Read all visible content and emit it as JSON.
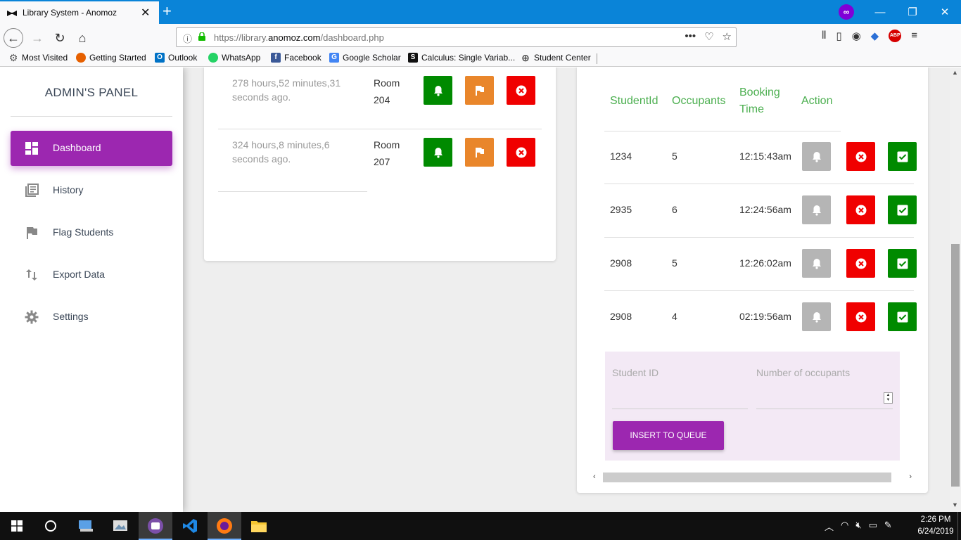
{
  "browser": {
    "tab_title": "Library System - Anomoz",
    "tab_close": "✕",
    "new_tab": "+",
    "url_prefix": "https://library.",
    "url_domain": "anomoz.com",
    "url_path": "/dashboard.php",
    "win_min": "—",
    "win_max": "❐",
    "win_close": "✕",
    "abp_label": "ABP"
  },
  "bookmarks": [
    {
      "label": "Most Visited",
      "icon": "gear-icon",
      "color": "#555555"
    },
    {
      "label": "Getting Started",
      "icon": "firefox-icon",
      "color": "#e66000"
    },
    {
      "label": "Outlook",
      "icon": "outlook-icon",
      "color": "#0072c6"
    },
    {
      "label": "WhatsApp",
      "icon": "whatsapp-icon",
      "color": "#25d366"
    },
    {
      "label": "Facebook",
      "icon": "facebook-icon",
      "color": "#3b5998"
    },
    {
      "label": "Google Scholar",
      "icon": "scholar-icon",
      "color": "#4285f4"
    },
    {
      "label": "Calculus: Single Variab...",
      "icon": "s-icon",
      "color": "#111111"
    },
    {
      "label": "Student Center",
      "icon": "globe-icon",
      "color": "#444444"
    }
  ],
  "sidebar": {
    "title": "ADMIN'S PANEL",
    "items": [
      {
        "label": "Dashboard",
        "icon": "dashboard-icon",
        "active": true
      },
      {
        "label": "History",
        "icon": "history-icon",
        "active": false
      },
      {
        "label": "Flag Students",
        "icon": "flag-icon",
        "active": false
      },
      {
        "label": "Export Data",
        "icon": "import-export-icon",
        "active": false
      },
      {
        "label": "Settings",
        "icon": "settings-icon",
        "active": false
      }
    ]
  },
  "active_bookings": [
    {
      "time": "278 hours,52 minutes,31 seconds ago.",
      "room": "Room 204"
    },
    {
      "time": "324 hours,8 minutes,6 seconds ago.",
      "room": "Room 207"
    }
  ],
  "queue": {
    "headers": {
      "student_id": "StudentId",
      "occupants": "Occupants",
      "booking_time": "Booking Time",
      "action": "Action"
    },
    "rows": [
      {
        "student_id": "1234",
        "occupants": "5",
        "time": "12:15:43am"
      },
      {
        "student_id": "2935",
        "occupants": "6",
        "time": "12:24:56am"
      },
      {
        "student_id": "2908",
        "occupants": "5",
        "time": "12:26:02am"
      },
      {
        "student_id": "2908",
        "occupants": "4",
        "time": "02:19:56am"
      }
    ],
    "form": {
      "student_id_placeholder": "Student ID",
      "occupants_placeholder": "Number of occupants",
      "insert_label": "INSERT TO QUEUE"
    }
  },
  "taskbar": {
    "time": "2:26 PM",
    "date": "6/24/2019"
  },
  "colors": {
    "accent_purple": "#9c27b0",
    "header_green": "#4caf50",
    "btn_green": "#008a00",
    "btn_orange": "#e9862b",
    "btn_red": "#f00000",
    "btn_grey": "#b5b5b5"
  }
}
